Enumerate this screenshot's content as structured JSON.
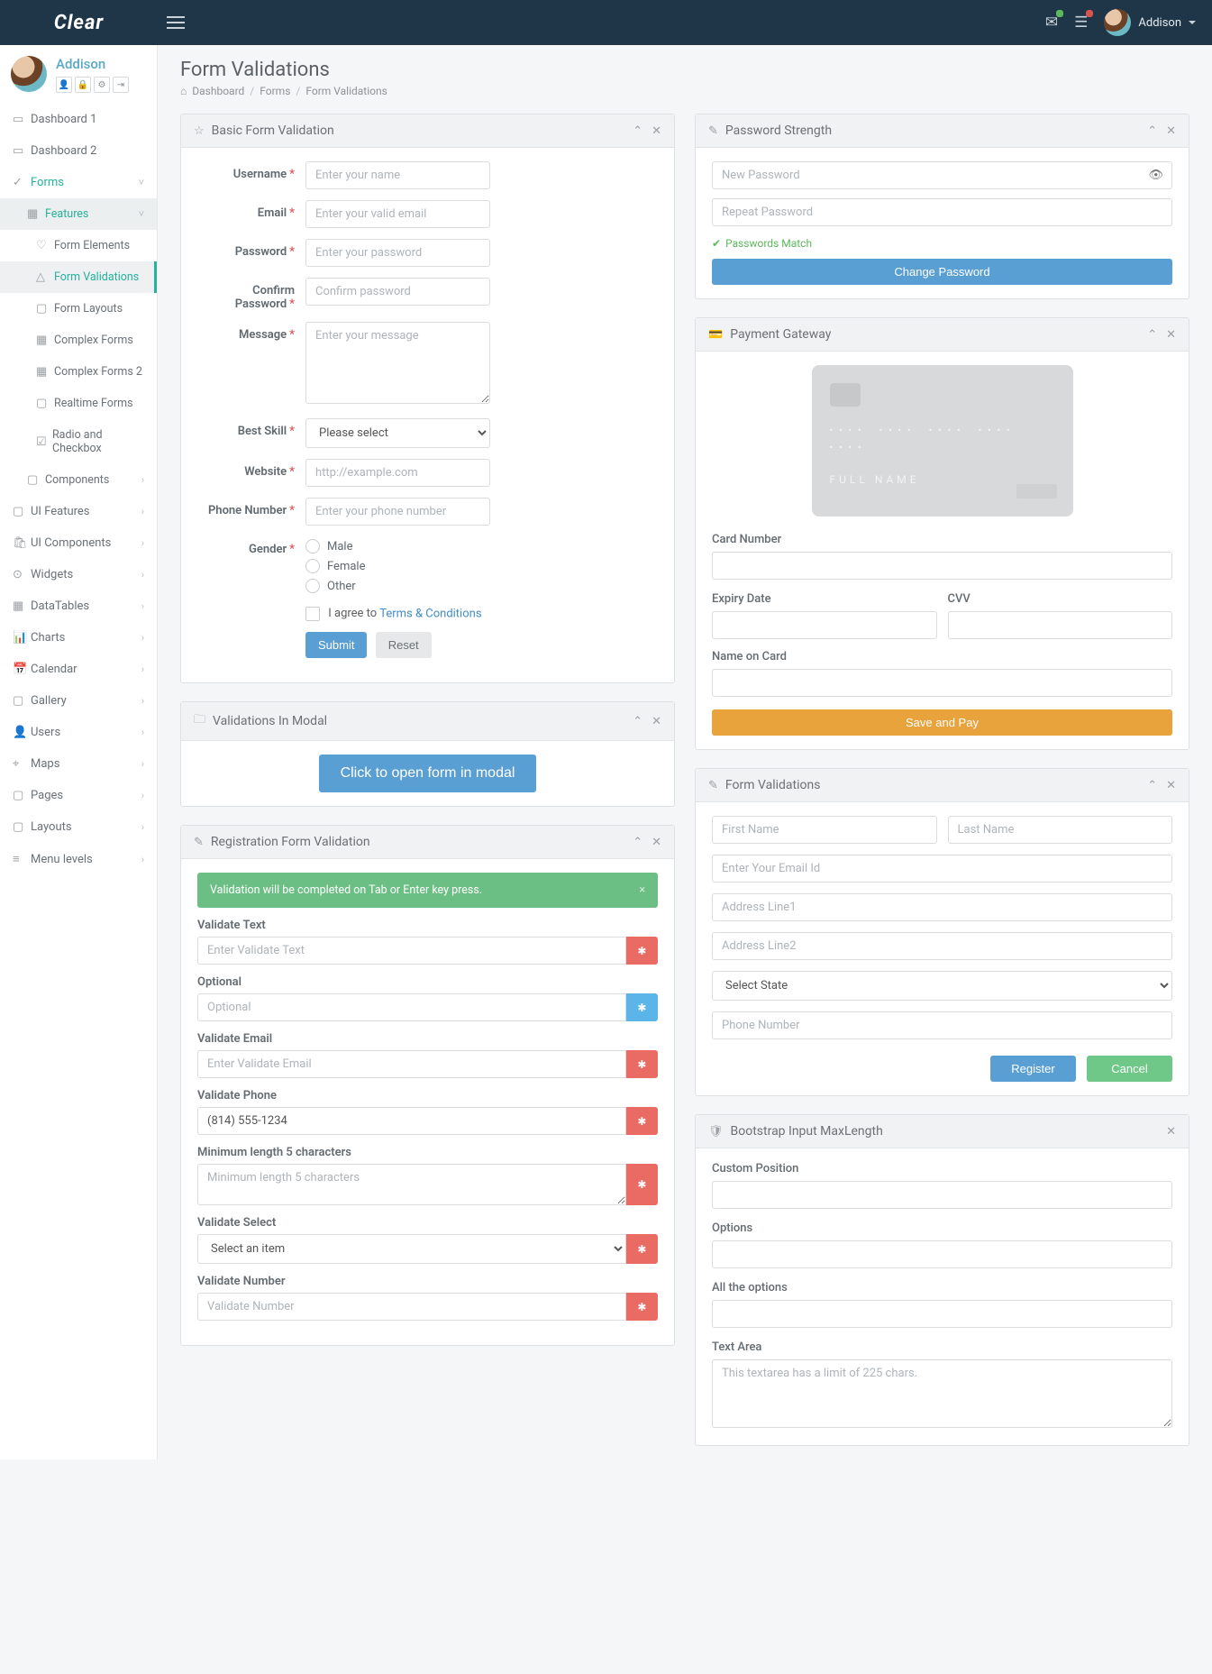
{
  "brand": "Clear",
  "user_name": "Addison",
  "page": {
    "title": "Form Validations",
    "crumbs": [
      "Dashboard",
      "Forms",
      "Form Validations"
    ]
  },
  "sidebar": {
    "profile_name": "Addison",
    "items": [
      {
        "label": "Dashboard 1",
        "icon": "▭"
      },
      {
        "label": "Dashboard 2",
        "icon": "▭"
      },
      {
        "label": "Forms",
        "icon": "✓",
        "open": true,
        "chev": "˅"
      },
      {
        "label": "Features",
        "icon": "▦",
        "sub": true,
        "open": true,
        "chev": "˅",
        "hl": true
      },
      {
        "label": "Form Elements",
        "icon": "♡",
        "sub2": true
      },
      {
        "label": "Form Validations",
        "icon": "△",
        "sub2": true,
        "active": true
      },
      {
        "label": "Form Layouts",
        "icon": "▢",
        "sub2": true
      },
      {
        "label": "Complex Forms",
        "icon": "▦",
        "sub2": true
      },
      {
        "label": "Complex Forms 2",
        "icon": "▦",
        "sub2": true
      },
      {
        "label": "Realtime Forms",
        "icon": "▢",
        "sub2": true
      },
      {
        "label": "Radio and Checkbox",
        "icon": "☑",
        "sub2": true
      },
      {
        "label": "Components",
        "icon": "▢",
        "sub": true,
        "chev": "›"
      },
      {
        "label": "UI Features",
        "icon": "▢",
        "chev": "›"
      },
      {
        "label": "UI Components",
        "icon": "🛍",
        "chev": "›"
      },
      {
        "label": "Widgets",
        "icon": "⊙",
        "chev": "›"
      },
      {
        "label": "DataTables",
        "icon": "▦",
        "chev": "›"
      },
      {
        "label": "Charts",
        "icon": "📊",
        "chev": "›"
      },
      {
        "label": "Calendar",
        "icon": "📅",
        "chev": "›"
      },
      {
        "label": "Gallery",
        "icon": "▢",
        "chev": "›"
      },
      {
        "label": "Users",
        "icon": "👤",
        "chev": "›"
      },
      {
        "label": "Maps",
        "icon": "⌖",
        "chev": "›"
      },
      {
        "label": "Pages",
        "icon": "▢",
        "chev": "›"
      },
      {
        "label": "Layouts",
        "icon": "▢",
        "chev": "›"
      },
      {
        "label": "Menu levels",
        "icon": "≡",
        "chev": "›"
      }
    ]
  },
  "basic": {
    "title": "Basic Form Validation",
    "fields": {
      "username": {
        "label": "Username",
        "ph": "Enter your name"
      },
      "email": {
        "label": "Email",
        "ph": "Enter your valid email"
      },
      "password": {
        "label": "Password",
        "ph": "Enter your password"
      },
      "confirm": {
        "label": "Confirm Password",
        "ph": "Confirm password"
      },
      "message": {
        "label": "Message",
        "ph": "Enter your message"
      },
      "skill": {
        "label": "Best Skill",
        "ph": "Please select"
      },
      "website": {
        "label": "Website",
        "ph": "http://example.com"
      },
      "phone": {
        "label": "Phone Number",
        "ph": "Enter your phone number"
      },
      "gender": {
        "label": "Gender",
        "opts": [
          "Male",
          "Female",
          "Other"
        ]
      },
      "agree_pre": "I agree to ",
      "agree_link": "Terms & Conditions",
      "submit": "Submit",
      "reset": "Reset"
    }
  },
  "modal": {
    "title": "Validations In Modal",
    "btn": "Click to open form in modal"
  },
  "reg": {
    "title": "Registration Form Validation",
    "alert": "Validation will be completed on Tab or Enter key press.",
    "f": {
      "vtext": {
        "label": "Validate Text",
        "ph": "Enter Validate Text"
      },
      "opt": {
        "label": "Optional",
        "ph": "Optional"
      },
      "vemail": {
        "label": "Validate Email",
        "ph": "Enter Validate Email"
      },
      "vphone": {
        "label": "Validate Phone",
        "val": "(814) 555-1234"
      },
      "min5": {
        "label": "Minimum length 5 characters",
        "ph": "Minimum length 5 characters"
      },
      "vsel": {
        "label": "Validate Select",
        "ph": "Select an item"
      },
      "vnum": {
        "label": "Validate Number",
        "ph": "Validate Number"
      }
    }
  },
  "pw": {
    "title": "Password Strength",
    "new_ph": "New Password",
    "repeat_ph": "Repeat Password",
    "match": "Passwords Match",
    "btn": "Change Password"
  },
  "pay": {
    "title": "Payment Gateway",
    "card_name": "FULL  NAME",
    "labels": {
      "card": "Card Number",
      "exp": "Expiry Date",
      "cvv": "CVV",
      "name": "Name on Card"
    },
    "btn": "Save and Pay"
  },
  "fv": {
    "title": "Form Validations",
    "ph": {
      "fn": "First Name",
      "ln": "Last Name",
      "email": "Enter Your Email Id",
      "a1": "Address Line1",
      "a2": "Address Line2",
      "state": "Select State",
      "phone": "Phone Number"
    },
    "register": "Register",
    "cancel": "Cancel"
  },
  "max": {
    "title": "Bootstrap Input MaxLength",
    "labels": {
      "pos": "Custom Position",
      "opt": "Options",
      "all": "All the options",
      "ta": "Text Area"
    },
    "ta_ph": "This textarea has a limit of 225 chars."
  }
}
